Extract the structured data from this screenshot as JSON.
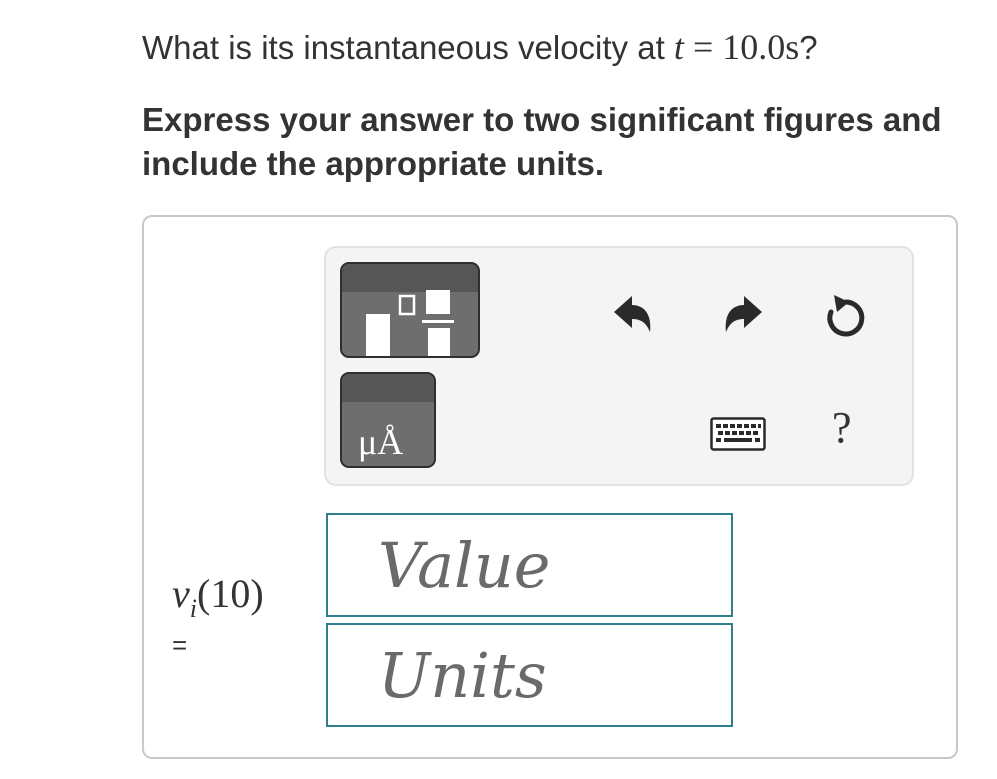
{
  "question": {
    "prefix": "What is its instantaneous velocity at ",
    "variable": "t",
    "equals": " = ",
    "value": "10.0s",
    "suffix": "?"
  },
  "instruction": "Express your answer to two significant figures and include the appropriate units.",
  "toolbar": {
    "units_symbol": "μÅ",
    "help_symbol": "?",
    "icons": [
      "fraction-template-icon",
      "units-template-icon",
      "undo-icon",
      "redo-icon",
      "reset-icon",
      "keyboard-icon",
      "help-icon"
    ]
  },
  "answer": {
    "variable": "v",
    "subscript": "i",
    "argument": "(10)",
    "equals": "=",
    "value_placeholder": "Value",
    "units_placeholder": "Units"
  },
  "colors": {
    "input_border": "#2f7d8f",
    "template_button": "#6e6e6e",
    "toolbar_bg": "#f4f4f4"
  }
}
